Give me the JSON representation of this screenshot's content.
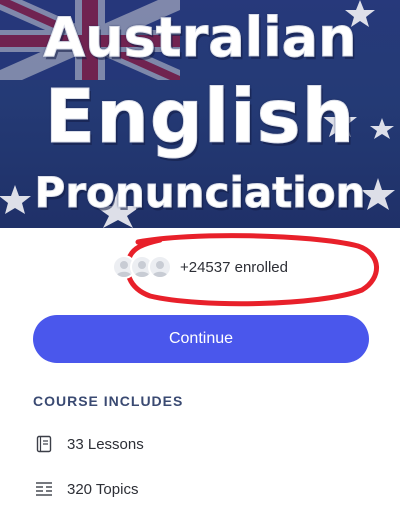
{
  "hero": {
    "line1": "Australian",
    "line2": "English",
    "line3": "Pronunciation"
  },
  "enrollment": {
    "text": "+24537 enrolled",
    "annotation_color": "#e8202a"
  },
  "actions": {
    "continue_label": "Continue"
  },
  "course_includes": {
    "title": "COURSE INCLUDES",
    "items": [
      {
        "icon": "book-icon",
        "label": "33 Lessons"
      },
      {
        "icon": "list-icon",
        "label": "320 Topics"
      }
    ]
  },
  "colors": {
    "accent": "#4a57ec",
    "section_title": "#3a4a72",
    "flag_blue": "#27407e",
    "flag_red": "#c8102e"
  }
}
